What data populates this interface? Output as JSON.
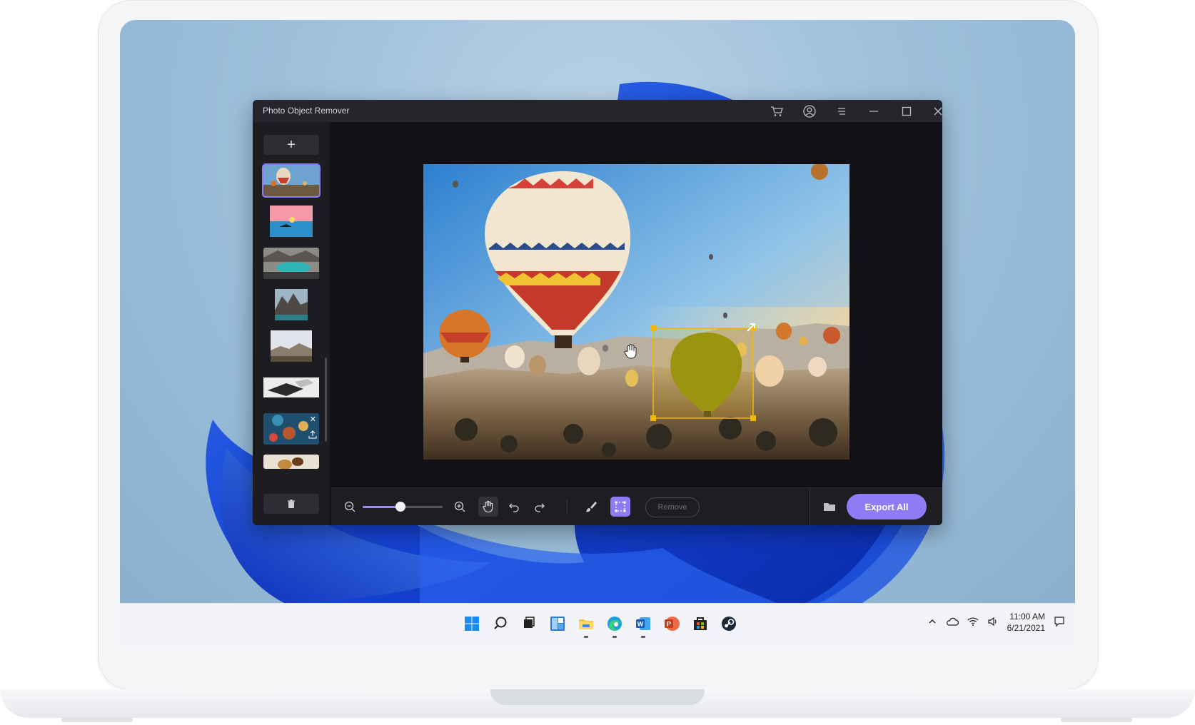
{
  "app": {
    "title": "Photo Object Remover",
    "titlebar_icons": [
      "cart-icon",
      "account-icon",
      "menu-icon",
      "minimize-icon",
      "maximize-icon",
      "close-icon"
    ]
  },
  "sidebar": {
    "add_label": "+",
    "thumbnails": [
      {
        "name": "hot-air-balloons",
        "selected": true
      },
      {
        "name": "sunset-sea",
        "selected": false
      },
      {
        "name": "turquoise-lake",
        "selected": false
      },
      {
        "name": "mountain-canyon",
        "selected": false
      },
      {
        "name": "misty-town",
        "selected": false
      },
      {
        "name": "desk-laptop",
        "selected": false
      },
      {
        "name": "food-table",
        "selected": false
      },
      {
        "name": "coffee-bread",
        "selected": false
      }
    ]
  },
  "toolbar": {
    "zoom_level": 0.47,
    "remove_label": "Remove",
    "export_label": "Export All",
    "tools": [
      "zoom-out-icon",
      "zoom-in-icon",
      "hand-icon",
      "undo-icon",
      "redo-icon",
      "brush-icon",
      "rect-select-icon",
      "folder-icon"
    ]
  },
  "taskbar": {
    "time": "11:00 AM",
    "date": "6/21/2021",
    "apps": [
      "windows-start-icon",
      "search-icon",
      "task-view-icon",
      "widgets-icon",
      "file-explorer-icon",
      "edge-icon",
      "word-icon",
      "powerpoint-icon",
      "store-icon",
      "steam-icon"
    ]
  },
  "colors": {
    "accent": "#8f7cf5",
    "selection": "#f2b705"
  }
}
